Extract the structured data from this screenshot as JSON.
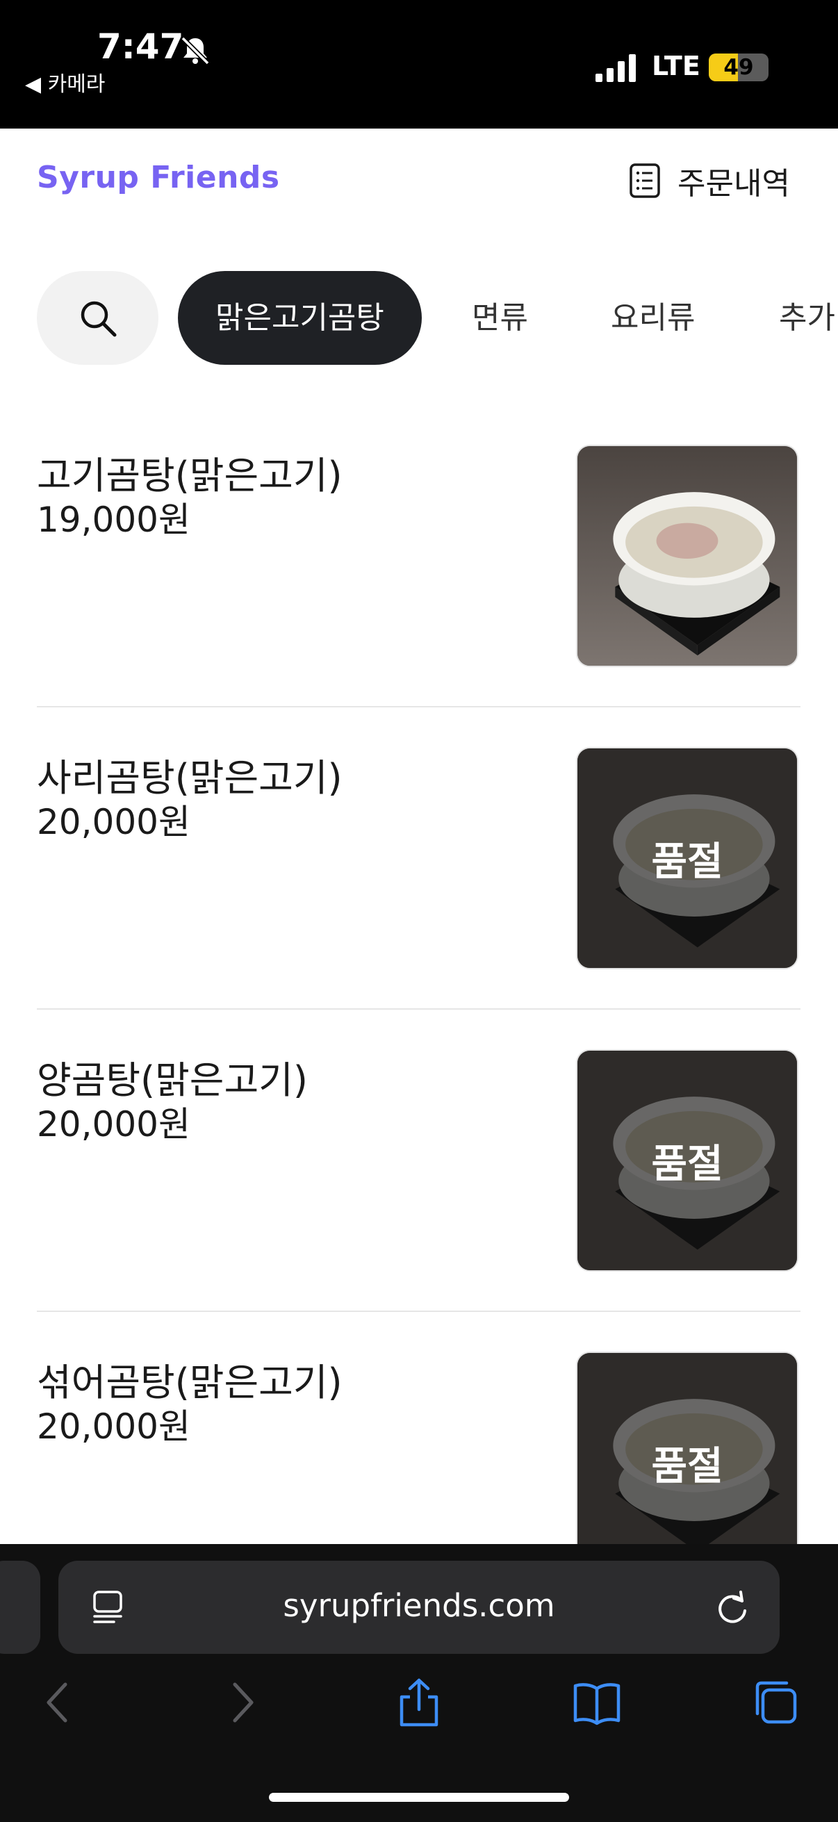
{
  "status_bar": {
    "time": "7:47",
    "back_label": "◀ 카메라",
    "network": "LTE",
    "battery": "49",
    "battery_fraction": 0.49,
    "icons": [
      "bell-slash-icon",
      "signal-bars-icon",
      "battery-icon"
    ]
  },
  "header": {
    "brand": "Syrup Friends",
    "orders_label": "주문내역",
    "brand_color": "#7763f2"
  },
  "categories": {
    "search_icon": "search-icon",
    "items": [
      "맑은고기곰탕",
      "면류",
      "요리류",
      "추가"
    ],
    "active_index": 0
  },
  "menu": {
    "items": [
      {
        "name": "고기곰탕(맑은고기)",
        "price": "19,000원",
        "sold_out": false
      },
      {
        "name": "사리곰탕(맑은고기)",
        "price": "20,000원",
        "sold_out": true,
        "badge": "품절"
      },
      {
        "name": "양곰탕(맑은고기)",
        "price": "20,000원",
        "sold_out": true,
        "badge": "품절"
      },
      {
        "name": "섞어곰탕(맑은고기)",
        "price": "20,000원",
        "sold_out": true,
        "badge": "품절"
      }
    ]
  },
  "browser": {
    "url": "syrupfriends.com",
    "buttons": [
      "back-icon",
      "forward-icon",
      "share-icon",
      "bookmarks-icon",
      "tabs-icon"
    ],
    "accent": "#3d8df5"
  }
}
